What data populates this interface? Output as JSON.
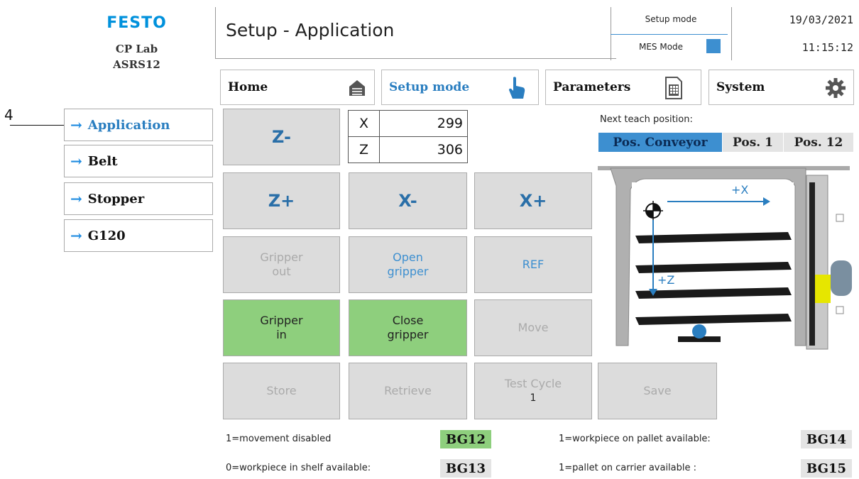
{
  "logo": {
    "brand": "FESTO",
    "line1": "CP Lab",
    "line2": "ASRS12"
  },
  "header": {
    "title": "Setup - Application",
    "mode1": "Setup mode",
    "mode2": "MES Mode",
    "date": "19/03/2021",
    "time": "11:15:12",
    "led_color": "#3d8fd0"
  },
  "nav": [
    {
      "label": "Home",
      "icon": "home-icon"
    },
    {
      "label": "Setup mode",
      "icon": "hand-pointer-icon"
    },
    {
      "label": "Parameters",
      "icon": "document-icon"
    },
    {
      "label": "System",
      "icon": "gear-icon"
    }
  ],
  "annotation": "4",
  "side_menu": [
    "Application",
    "Belt",
    "Stopper",
    "G120"
  ],
  "coords": {
    "x_label": "X",
    "x_value": "299",
    "z_label": "Z",
    "z_value": "306"
  },
  "buttons": {
    "z_minus": "Z-",
    "z_plus": "Z+",
    "x_minus": "X-",
    "x_plus": "X+",
    "gripper_out_1": "Gripper",
    "gripper_out_2": "out",
    "open_gripper_1": "Open",
    "open_gripper_2": "gripper",
    "ref": "REF",
    "gripper_in_1": "Gripper",
    "gripper_in_2": "in",
    "close_gripper_1": "Close",
    "close_gripper_2": "gripper",
    "move": "Move",
    "store": "Store",
    "retrieve": "Retrieve",
    "test_cycle": "Test Cycle",
    "test_cycle_count": "1",
    "save": "Save"
  },
  "teach": {
    "label": "Next teach position:",
    "positions": [
      "Pos. Conveyor",
      "Pos. 1",
      "Pos. 12"
    ],
    "selected": "Pos. Conveyor"
  },
  "diagram": {
    "x_axis": "+X",
    "z_axis": "+Z"
  },
  "status": {
    "movement_disabled": "1=movement disabled",
    "bg12": "BG12",
    "workpiece_shelf": "0=workpiece in shelf available:",
    "bg13": "BG13",
    "workpiece_pallet": "1=workpiece on pallet available:",
    "bg14": "BG14",
    "pallet_carrier": "1=pallet on carrier available :",
    "bg15": "BG15"
  },
  "colors": {
    "accent": "#3d8fd0",
    "green": "#8ecf7d",
    "brand": "#0091dc"
  }
}
